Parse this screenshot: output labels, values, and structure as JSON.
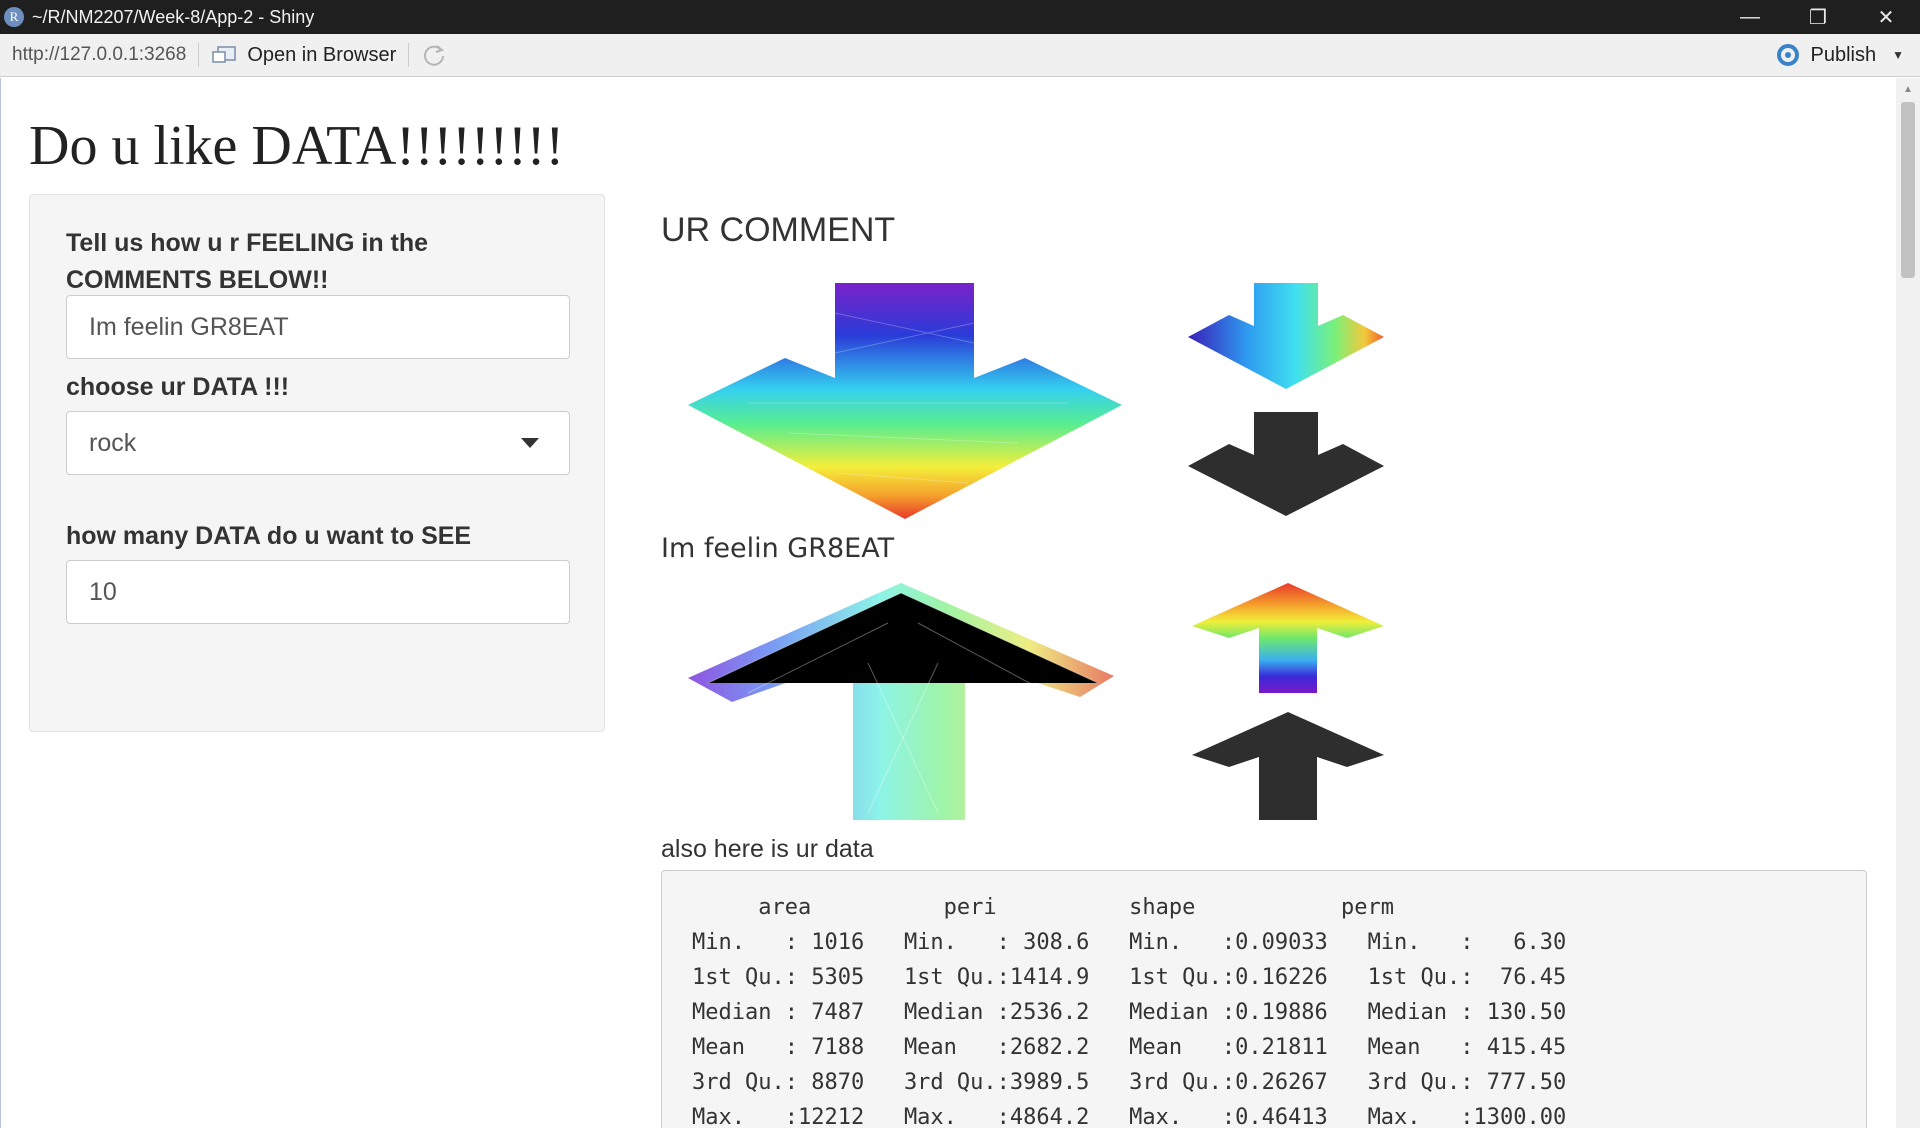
{
  "window": {
    "icon": "R",
    "title": "~/R/NM2207/Week-8/App-2 - Shiny",
    "controls": {
      "minimize": "—",
      "restore": "❐",
      "close": "✕"
    }
  },
  "toolbar": {
    "url": "http://127.0.0.1:3268",
    "open_browser": "Open in Browser",
    "refresh_icon": "refresh-icon",
    "publish": "Publish"
  },
  "app": {
    "title": "Do u like DATA!!!!!!!!!",
    "sidebar": {
      "comment_label": "Tell us how u r FEELING in the COMMENTS BELOW!!",
      "comment_value": "Im feelin GR8EAT",
      "dataset_label": "choose ur DATA !!!",
      "dataset_value": "rock",
      "count_label": "how many DATA do u want to SEE",
      "count_value": "10"
    },
    "main": {
      "comment_heading": "UR COMMENT",
      "comment_echo": "Im feelin GR8EAT",
      "data_intro": "also here is ur data",
      "summary": {
        "columns": [
          "area",
          "peri",
          "shape",
          "perm"
        ],
        "rows": [
          [
            "Min.   : 1016",
            "Min.   : 308.6",
            "Min.   :0.09033",
            "Min.   :   6.30"
          ],
          [
            "1st Qu.: 5305",
            "1st Qu.:1414.9",
            "1st Qu.:0.16226",
            "1st Qu.:  76.45"
          ],
          [
            "Median : 7487",
            "Median :2536.2",
            "Median :0.19886",
            "Median : 130.50"
          ],
          [
            "Mean   : 7188",
            "Mean   :2682.2",
            "Mean   :0.21811",
            "Mean   : 415.45"
          ],
          [
            "3rd Qu.: 8870",
            "3rd Qu.:3989.5",
            "3rd Qu.:0.26267",
            "3rd Qu.: 777.50"
          ],
          [
            "Max.   :12212",
            "Max.   :4864.2",
            "Max.   :0.46413",
            "Max.   :1300.00"
          ]
        ]
      }
    }
  },
  "colors": {
    "titlebar": "#1f1f1f",
    "toolbar": "#f0f0f0",
    "accent": "#4a86c5"
  }
}
